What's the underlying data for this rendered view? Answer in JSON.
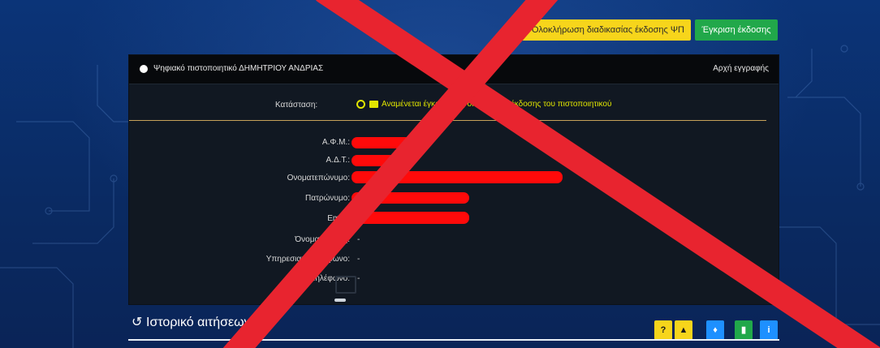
{
  "toolbar": {
    "complete_process_label": "Ολοκλήρωση διαδικασίας έκδοσης ΨΠ",
    "approve_issue_label": "Έγκριση έκδοσης"
  },
  "certificate": {
    "title": "Ψηφιακό πιστοποιητικό ΔΗΜΗΤΡΙΟΥ ΑΝΔΡΙΑΣ",
    "header_right": "Αρχή εγγραφής",
    "status_label": "Κατάσταση:",
    "status_text": "Αναμένεται έγκριση της διαδικασίας έκδοσης του πιστοποιητικού",
    "fields": [
      {
        "label": "Α.Φ.Μ.:"
      },
      {
        "label": "Α.Δ.Τ.:"
      },
      {
        "label": "Ονοματεπώνυμο:"
      },
      {
        "label": "Πατρώνυμο:"
      },
      {
        "label": "Email:"
      },
      {
        "label": "Όνομα χρήστη:",
        "value": "-"
      },
      {
        "label": "Υπηρεσιακό τηλέφωνο:",
        "value": "-"
      },
      {
        "label": "Κινητό τηλέφωνο:",
        "value": "-"
      }
    ]
  },
  "history": {
    "title": "Ιστορικό αιτήσεων",
    "buttons": [
      {
        "icon": "help-icon",
        "glyph": "?",
        "color": "#f7d51b"
      },
      {
        "icon": "lock-icon",
        "glyph": "▲",
        "color": "#f7d51b"
      },
      {
        "icon": "bell-icon",
        "glyph": "♦",
        "color": "#1e90ff"
      },
      {
        "icon": "document-icon",
        "glyph": "▮",
        "color": "#21a84a"
      },
      {
        "icon": "info-icon",
        "glyph": "i",
        "color": "#1e90ff"
      }
    ]
  },
  "overlay": {
    "cross_color": "#e8242f"
  },
  "colors": {
    "background": "#0a2d6b",
    "panel": "#111822",
    "status_yellow": "#e2e600",
    "redaction": "#ff0a0a"
  }
}
